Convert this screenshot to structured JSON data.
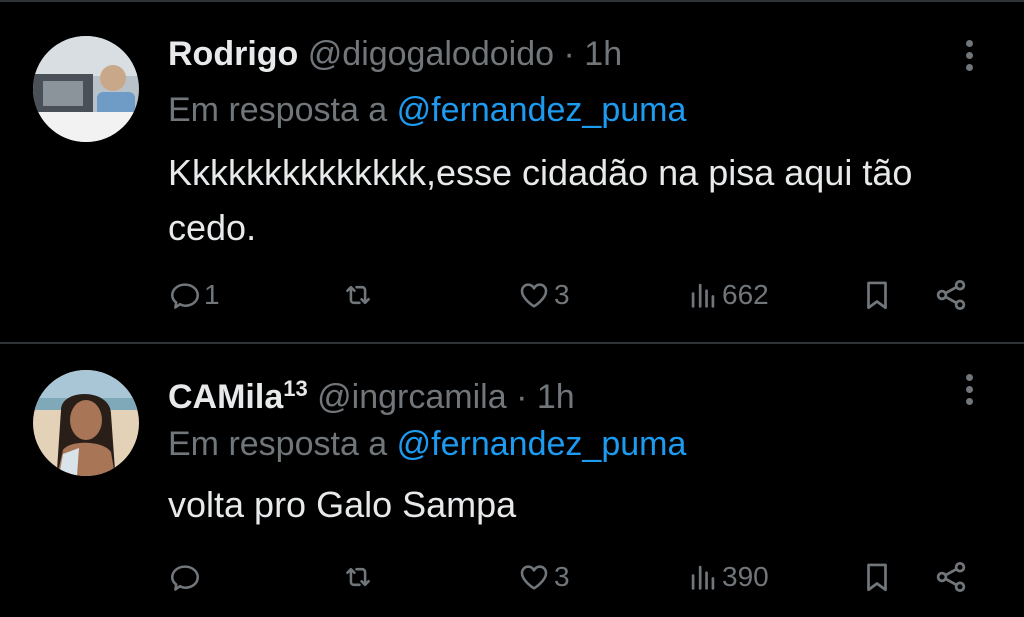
{
  "colors": {
    "background": "#000000",
    "primary_text": "#e7e9ea",
    "secondary_text": "#71767b",
    "link": "#1d9bf0",
    "divider": "#2f3336"
  },
  "tweets": [
    {
      "name": "Rodrigo",
      "name_suffix": "",
      "handle": "@digogalodoido",
      "separator": "·",
      "time": "1h",
      "reply_prefix": "Em resposta a",
      "reply_mention": "@fernandez_puma",
      "text": "Kkkkkkkkkkkkkk,esse cidadão na pisa aqui tão cedo.",
      "replies": "1",
      "retweets": "",
      "likes": "3",
      "views": "662",
      "avatar_icon": "avatar-man-in-car"
    },
    {
      "name": "CAMila",
      "name_suffix": "13",
      "handle": "@ingrcamila",
      "separator": "·",
      "time": "1h",
      "reply_prefix": "Em resposta a",
      "reply_mention": "@fernandez_puma",
      "text": "volta pro Galo Sampa",
      "replies": "",
      "retweets": "",
      "likes": "3",
      "views": "390",
      "avatar_icon": "avatar-woman-beach"
    }
  ]
}
